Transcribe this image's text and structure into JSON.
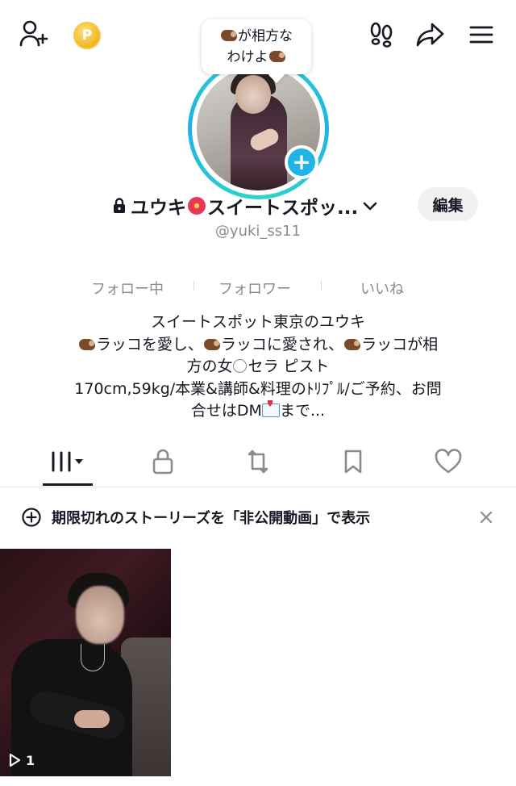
{
  "header": {
    "bubble_line1": "が相方な",
    "bubble_line2": "わけよ",
    "coin_letter": "P"
  },
  "profile": {
    "name": "ユウキ",
    "name_rest": "スイートスポッ...",
    "username": "@yuki_ss11",
    "edit_label": "編集",
    "accent_color": "#20b3e6"
  },
  "stats": [
    {
      "label": "フォロー中"
    },
    {
      "label": "フォロワー"
    },
    {
      "label": "いいね"
    }
  ],
  "bio": {
    "line1": "スイートスポット東京のユウキ",
    "line2_a": "ラッコを愛し、",
    "line2_b": "ラッコに愛され、",
    "line2_c": "ラッコが相",
    "line3_a": "方の女",
    "line3_b": "セラ ピスト",
    "line4": "170cm,59kg/本業&講師&料理のﾄﾘﾌﾟﾙ/ご予約、お問",
    "line5_a": "合せはDM",
    "line5_b": "まで..."
  },
  "tabs": [
    {
      "name": "videos",
      "icon": "grid-icon"
    },
    {
      "name": "private",
      "icon": "lock-icon"
    },
    {
      "name": "reposts",
      "icon": "repost-icon"
    },
    {
      "name": "favorites",
      "icon": "bookmark-icon"
    },
    {
      "name": "liked",
      "icon": "heart-icon"
    }
  ],
  "story_bar": {
    "text": "期限切れのストーリーズを「非公開動画」で表示"
  },
  "videos": [
    {
      "views": "1"
    }
  ]
}
